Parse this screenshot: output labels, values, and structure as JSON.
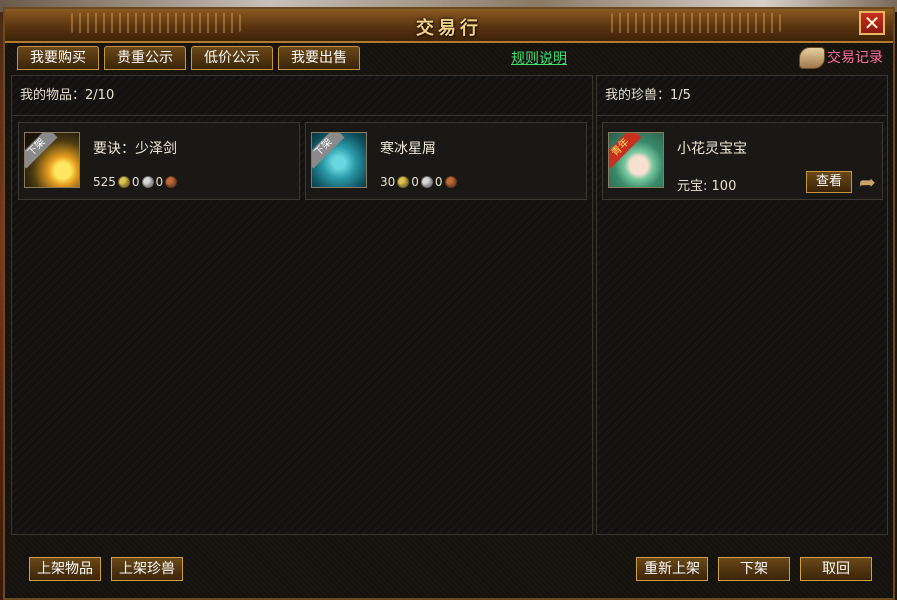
{
  "window": {
    "title": "交易行"
  },
  "tabs": [
    {
      "label": "我要购买"
    },
    {
      "label": "贵重公示"
    },
    {
      "label": "低价公示"
    },
    {
      "label": "我要出售"
    }
  ],
  "rules_link": "规则说明",
  "records_link": "交易记录",
  "items_panel": {
    "label": "我的物品：",
    "count": "2/10",
    "items": [
      {
        "badge": "下架",
        "name": "要诀：少泽剑",
        "gold": "525",
        "silver": "0",
        "copper": "0"
      },
      {
        "badge": "下架",
        "name": "寒冰星屑",
        "gold": "30",
        "silver": "0",
        "copper": "0"
      }
    ]
  },
  "pets_panel": {
    "label": "我的珍兽：",
    "count": "1/5",
    "pets": [
      {
        "badge": "青年",
        "name": "小花灵宝宝",
        "price_label": "元宝:",
        "price": "100",
        "view_label": "查看"
      }
    ]
  },
  "bottom_buttons": {
    "list_item": "上架物品",
    "list_pet": "上架珍兽",
    "relist": "重新上架",
    "delist": "下架",
    "cancel": "取回"
  },
  "colors": {
    "gold_text": "#f2d188",
    "rules_link": "#3ee070",
    "records_link": "#ff6aa0",
    "button_border": "#d0a040"
  }
}
